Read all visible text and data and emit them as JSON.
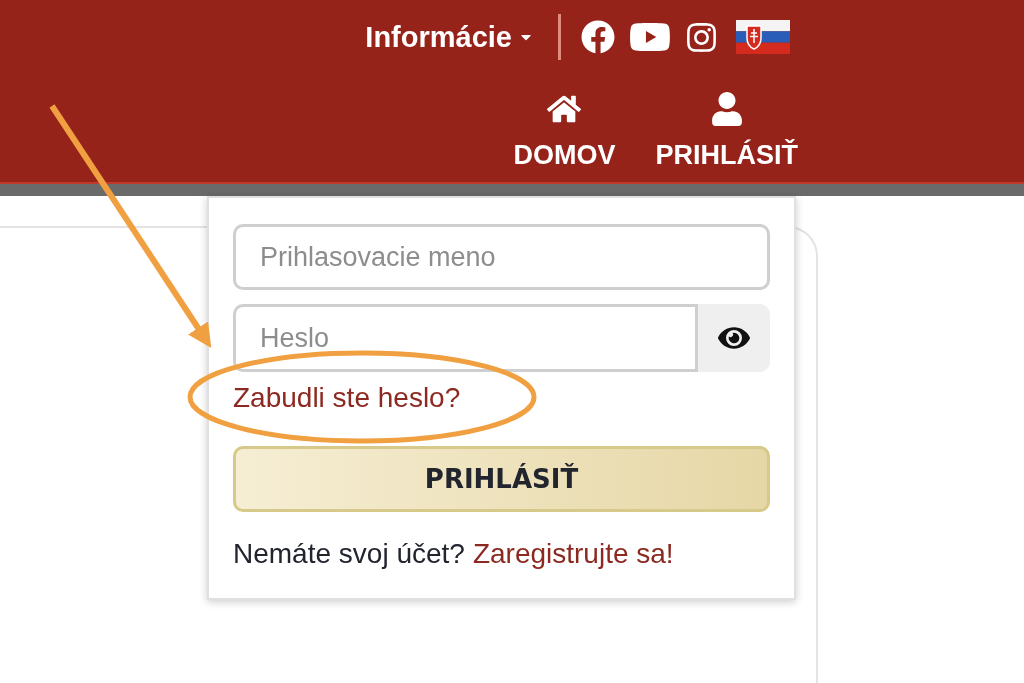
{
  "header": {
    "info_menu": {
      "label": "Informácie"
    },
    "nav": [
      {
        "kind": "home",
        "label": "DOMOV"
      },
      {
        "kind": "user",
        "label": "PRIHLÁSIŤ"
      }
    ]
  },
  "login": {
    "username": {
      "placeholder": "Prihlasovacie meno"
    },
    "password": {
      "placeholder": "Heslo"
    },
    "forgot_link": "Zabudli ste heslo?",
    "submit": "PRIHLÁSIŤ",
    "register_prompt": "Nemáte svoj účet?",
    "register_link": "Zaregistrujte sa!"
  }
}
